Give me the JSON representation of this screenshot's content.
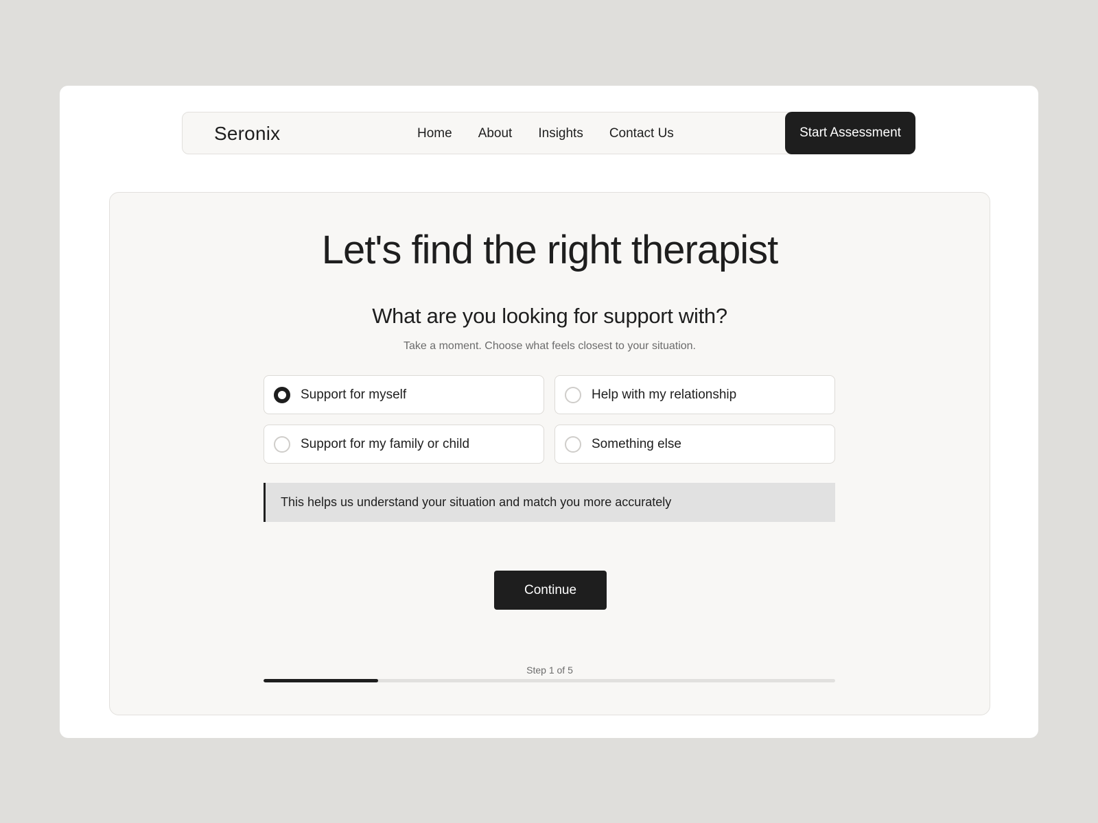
{
  "nav": {
    "brand": "Seronix",
    "links": [
      "Home",
      "About",
      "Insights",
      "Contact Us"
    ],
    "cta_label": "Start Assessment"
  },
  "main": {
    "title": "Let's find the right therapist",
    "question": "What are you looking for support with?",
    "helper": "Take a moment. Choose what feels closest to your situation.",
    "options": [
      {
        "label": "Support for myself",
        "selected": true
      },
      {
        "label": "Help with my relationship",
        "selected": false
      },
      {
        "label": "Support for my family or child",
        "selected": false
      },
      {
        "label": "Something else",
        "selected": false
      }
    ],
    "note": "This helps us understand your situation and match you more accurately",
    "continue_label": "Continue",
    "step_label": "Step 1 of 5",
    "progress_fraction": 0.2
  },
  "colors": {
    "accent": "#1e1e1e",
    "page_bg": "#dfdedb",
    "card_bg": "#f8f7f5",
    "note_bg": "#e1e1e1"
  }
}
